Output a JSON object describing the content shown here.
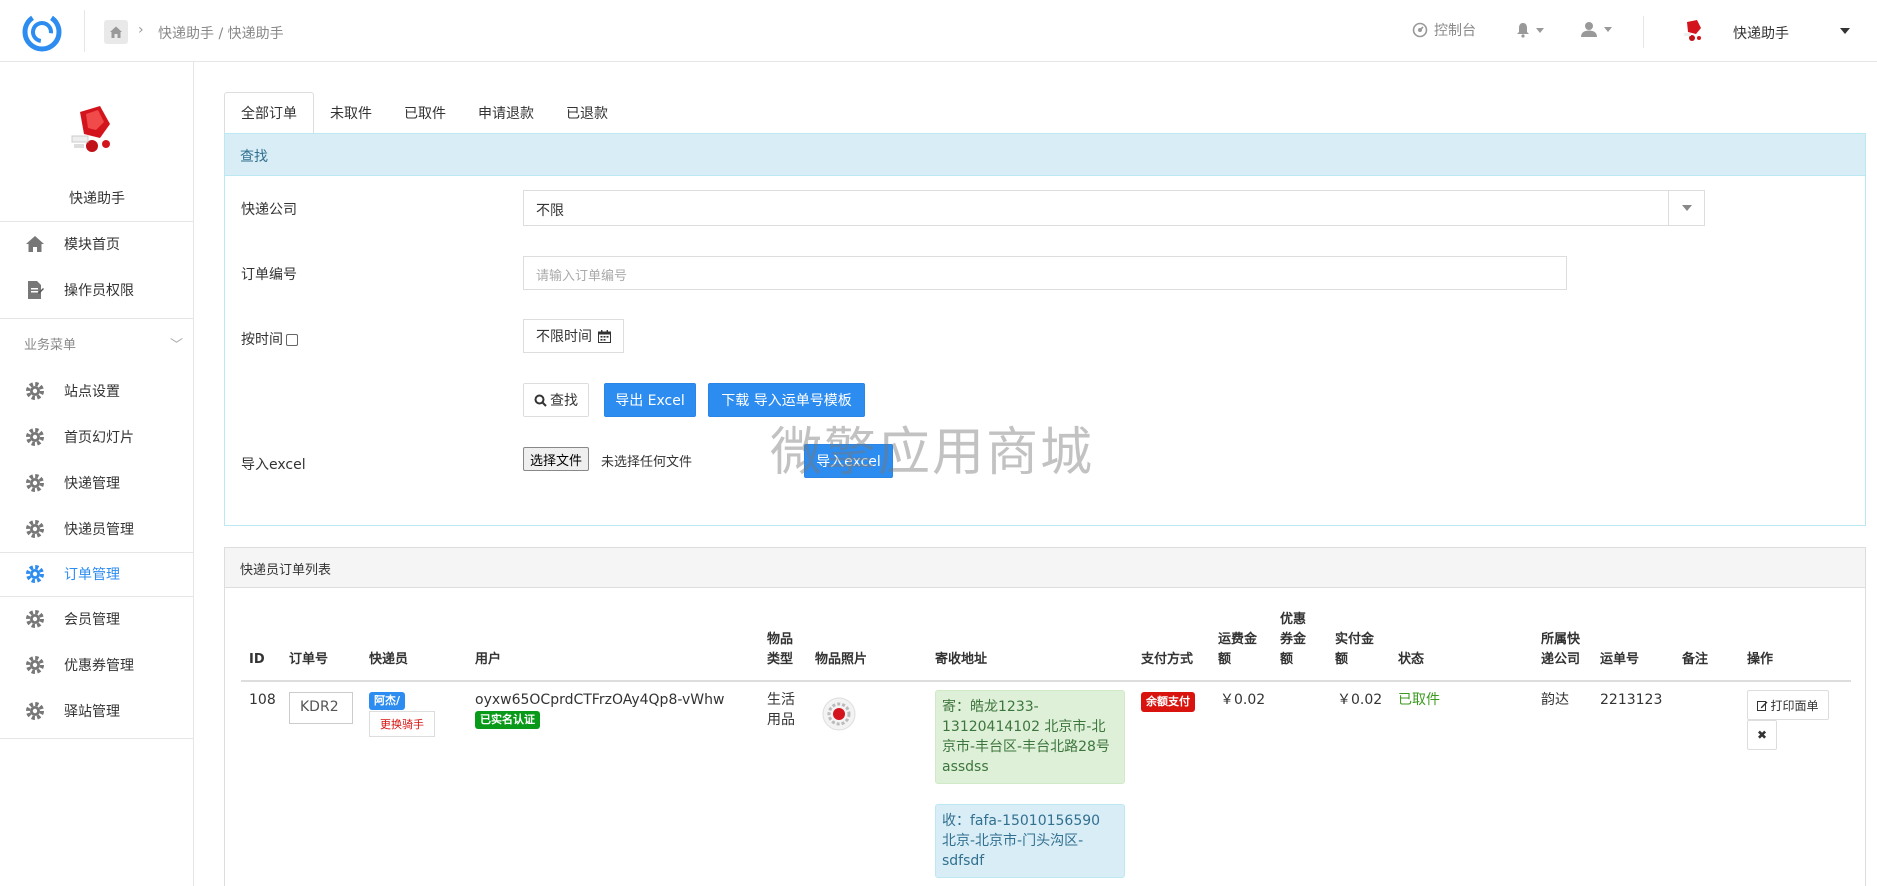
{
  "header": {
    "breadcrumb": "快递助手 / 快递助手",
    "console_label": "控制台",
    "username": "快递助手"
  },
  "sidebar": {
    "app_name": "快递助手",
    "top_items": [
      {
        "label": "模块首页",
        "icon": "home-icon"
      },
      {
        "label": "操作员权限",
        "icon": "document-edit-icon"
      }
    ],
    "group_label": "业务菜单",
    "items": [
      {
        "label": "站点设置",
        "icon": "gear-icon"
      },
      {
        "label": "首页幻灯片",
        "icon": "gear-icon"
      },
      {
        "label": "快递管理",
        "icon": "gear-icon"
      },
      {
        "label": "快递员管理",
        "icon": "gear-icon"
      },
      {
        "label": "订单管理",
        "icon": "gear-icon",
        "active": true
      },
      {
        "label": "会员管理",
        "icon": "gear-icon"
      },
      {
        "label": "优惠券管理",
        "icon": "gear-icon"
      },
      {
        "label": "驿站管理",
        "icon": "gear-icon"
      }
    ],
    "active_color": "#2d8cf0"
  },
  "tabs": [
    {
      "label": "全部订单",
      "active": true
    },
    {
      "label": "未取件"
    },
    {
      "label": "已取件"
    },
    {
      "label": "申请退款"
    },
    {
      "label": "已退款"
    }
  ],
  "search": {
    "title": "查找",
    "company_label": "快递公司",
    "company_value": "不限",
    "order_label": "订单编号",
    "order_placeholder": "请输入订单编号",
    "time_label": "按时间",
    "time_value": "不限时间",
    "search_btn": "查找",
    "export_btn": "导出 Excel",
    "template_btn": "下载 导入运单号模板",
    "import_label": "导入excel",
    "file_btn": "选择文件",
    "file_none": "未选择任何文件",
    "import_btn": "导入excel"
  },
  "watermark": "微擎应用商城",
  "list": {
    "title": "快递员订单列表",
    "headers": {
      "id": "ID",
      "order_no": "订单号",
      "courier": "快递员",
      "user": "用户",
      "item_type": "物品类型",
      "item_photo": "物品照片",
      "address": "寄收地址",
      "pay_method": "支付方式",
      "freight": "运费金额",
      "coupon": "优惠券金额",
      "paid": "实付金额",
      "status": "状态",
      "company": "所属快递公司",
      "waybill": "运单号",
      "remark": "备注",
      "ops": "操作"
    },
    "rows": [
      {
        "id": "108",
        "order_no": "KDR2",
        "courier_badge": "阿杰/",
        "change_courier": "更换骑手",
        "user": "oyxw65OCprdCTFrzOAy4Qp8-vWhw",
        "user_badge": "已实名认证",
        "item_type": "生活用品",
        "sender": "寄：皓龙1233-13120414102 北京市-北京市-丰台区-丰台北路28号assdss",
        "receiver": "收：fafa-15010156590 北京-北京市-门头沟区-sdfsdf",
        "pay_method": "余额支付",
        "freight": "￥0.02",
        "coupon": "",
        "paid": "￥0.02",
        "status": "已取件",
        "company": "韵达",
        "waybill": "2213123",
        "remark": "",
        "print_btn": "打印面单"
      }
    ]
  },
  "colors": {
    "primary": "#2d8cf0",
    "danger": "#d9140f",
    "success": "#0a9a1a",
    "status_green": "#3c9a1e"
  }
}
